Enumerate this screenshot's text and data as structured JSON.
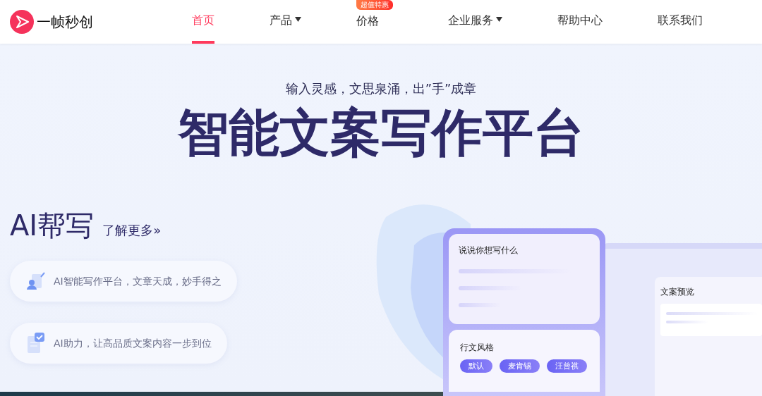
{
  "header": {
    "logo_text": "一帧秒创",
    "nav": [
      {
        "label": "首页",
        "selected": true,
        "dropdown": false
      },
      {
        "label": "产品",
        "selected": false,
        "dropdown": true
      },
      {
        "label": "价格",
        "selected": false,
        "dropdown": false,
        "badge": "超值特惠"
      },
      {
        "label": "企业服务",
        "selected": false,
        "dropdown": true
      },
      {
        "label": "帮助中心",
        "selected": false,
        "dropdown": false
      },
      {
        "label": "联系我们",
        "selected": false,
        "dropdown": false
      }
    ]
  },
  "hero": {
    "tagline": "输入灵感，文思泉涌，出”手”成章",
    "title": "智能文案写作平台"
  },
  "ai_section": {
    "heading": "AI帮写",
    "more_link": "了解更多»",
    "features": [
      {
        "kind": "writer",
        "text": "AI智能写作平台，文章天成，妙手得之"
      },
      {
        "kind": "document",
        "text": "AI助力，让高品质文案内容一步到位"
      }
    ]
  },
  "mockup": {
    "prompt_title": "说说你想写什么",
    "style_title": "行文风格",
    "styles": [
      "默认",
      "麦肯锡",
      "汪曾祺"
    ],
    "preview_title": "文案预览"
  }
}
